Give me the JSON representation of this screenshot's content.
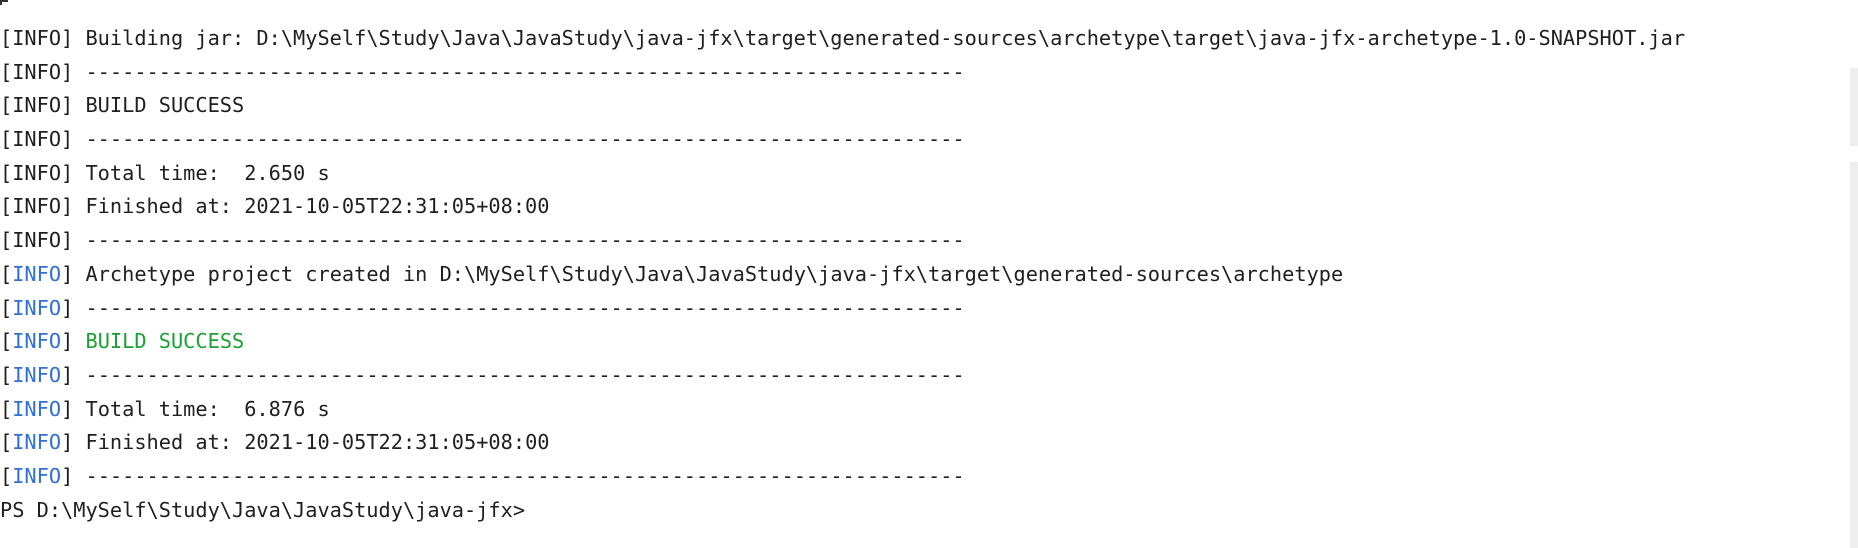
{
  "terminal": {
    "lines": [
      {
        "prefix": "[INFO]",
        "text": " Building jar: D:\\MySelf\\Study\\Java\\JavaStudy\\java-jfx\\target\\generated-sources\\archetype\\target\\java-jfx-archetype-1.0-SNAPSHOT.jar"
      },
      {
        "prefix": "[INFO]",
        "text": " ------------------------------------------------------------------------"
      },
      {
        "prefix": "[INFO]",
        "text": " BUILD SUCCESS"
      },
      {
        "prefix": "[INFO]",
        "text": " ------------------------------------------------------------------------"
      },
      {
        "prefix": "[INFO]",
        "text": " Total time:  2.650 s"
      },
      {
        "prefix": "[INFO]",
        "text": " Finished at: 2021-10-05T22:31:05+08:00"
      },
      {
        "prefix": "[INFO]",
        "text": " ------------------------------------------------------------------------"
      },
      {
        "tag_open": "[",
        "tag": "INFO",
        "tag_close": "]",
        "text": " Archetype project created in D:\\MySelf\\Study\\Java\\JavaStudy\\java-jfx\\target\\generated-sources\\archetype"
      },
      {
        "tag_open": "[",
        "tag": "INFO",
        "tag_close": "]",
        "text": " ------------------------------------------------------------------------"
      },
      {
        "tag_open": "[",
        "tag": "INFO",
        "tag_close": "]",
        "space": " ",
        "text": "BUILD SUCCESS"
      },
      {
        "tag_open": "[",
        "tag": "INFO",
        "tag_close": "]",
        "text": " ------------------------------------------------------------------------"
      },
      {
        "tag_open": "[",
        "tag": "INFO",
        "tag_close": "]",
        "text": " Total time:  6.876 s"
      },
      {
        "tag_open": "[",
        "tag": "INFO",
        "tag_close": "]",
        "text": " Finished at: 2021-10-05T22:31:05+08:00"
      },
      {
        "tag_open": "[",
        "tag": "INFO",
        "tag_close": "]",
        "text": " ------------------------------------------------------------------------"
      }
    ],
    "prompt": "PS D:\\MySelf\\Study\\Java\\JavaStudy\\java-jfx>"
  },
  "colors": {
    "background": "#ffffff",
    "text": "#1f1f1f",
    "info_tag_blue": "#2f6fd6",
    "success_green": "#1aa033"
  }
}
